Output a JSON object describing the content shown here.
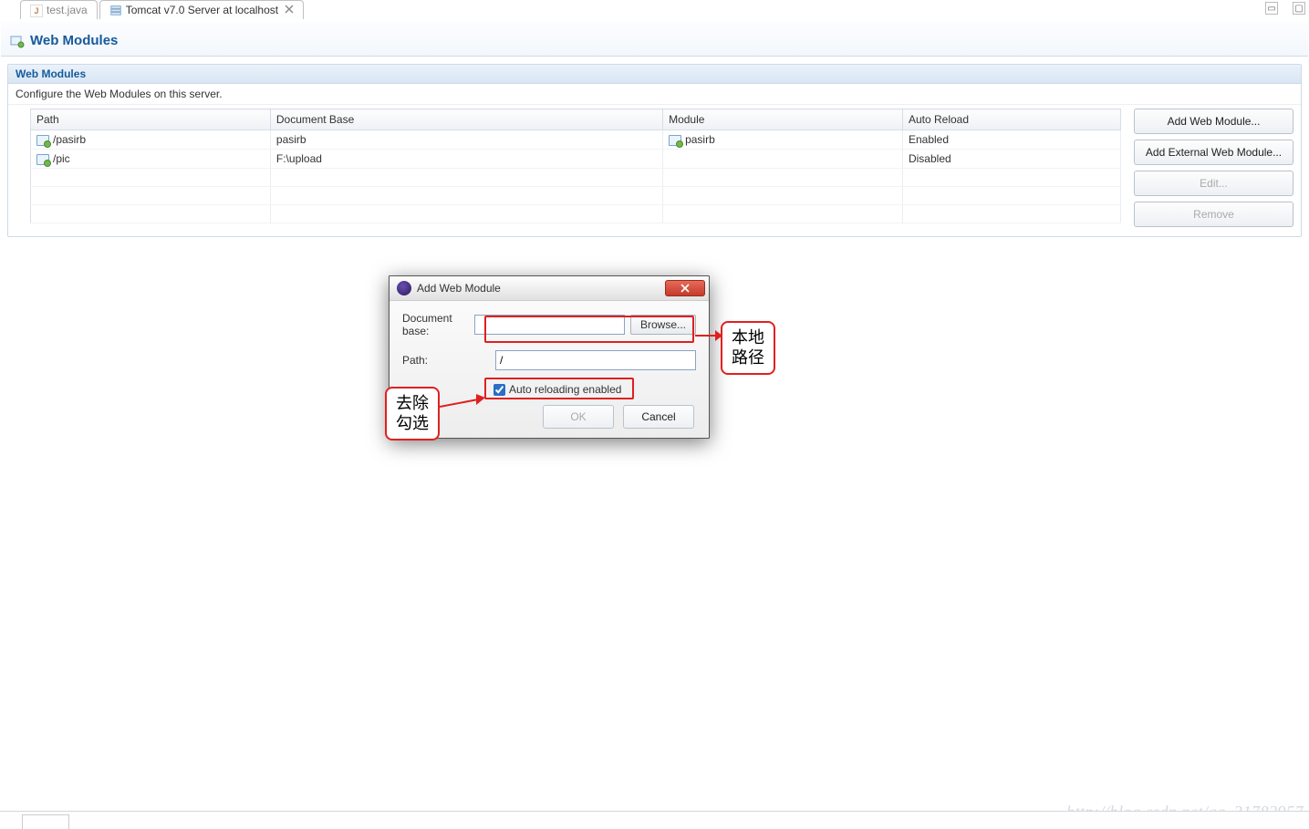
{
  "tabs": {
    "inactive": {
      "label": "test.java"
    },
    "active": {
      "label": "Tomcat v7.0 Server at localhost"
    }
  },
  "header": {
    "title": "Web Modules"
  },
  "section": {
    "title": "Web Modules",
    "subtitle": "Configure the Web Modules on this server."
  },
  "table": {
    "headers": {
      "path": "Path",
      "docbase": "Document Base",
      "module": "Module",
      "reload": "Auto Reload"
    },
    "rows": [
      {
        "path": "/pasirb",
        "docbase": "pasirb",
        "module": "pasirb",
        "reload": "Enabled"
      },
      {
        "path": "/pic",
        "docbase": "F:\\upload",
        "module": "",
        "reload": "Disabled"
      }
    ]
  },
  "buttons": {
    "add": "Add Web Module...",
    "addExt": "Add External Web Module...",
    "edit": "Edit...",
    "remove": "Remove"
  },
  "dialog": {
    "title": "Add Web Module",
    "docbaseLabel": "Document base:",
    "docbaseValue": "",
    "browse": "Browse...",
    "pathLabel": "Path:",
    "pathValue": "/",
    "checkboxLabel": "Auto reloading enabled",
    "checkboxChecked": true,
    "ok": "OK",
    "cancel": "Cancel"
  },
  "callouts": {
    "right": "本地\n路径",
    "left": "去除\n勾选"
  },
  "watermark": "http://blog.csdn.net/qq_31782957"
}
